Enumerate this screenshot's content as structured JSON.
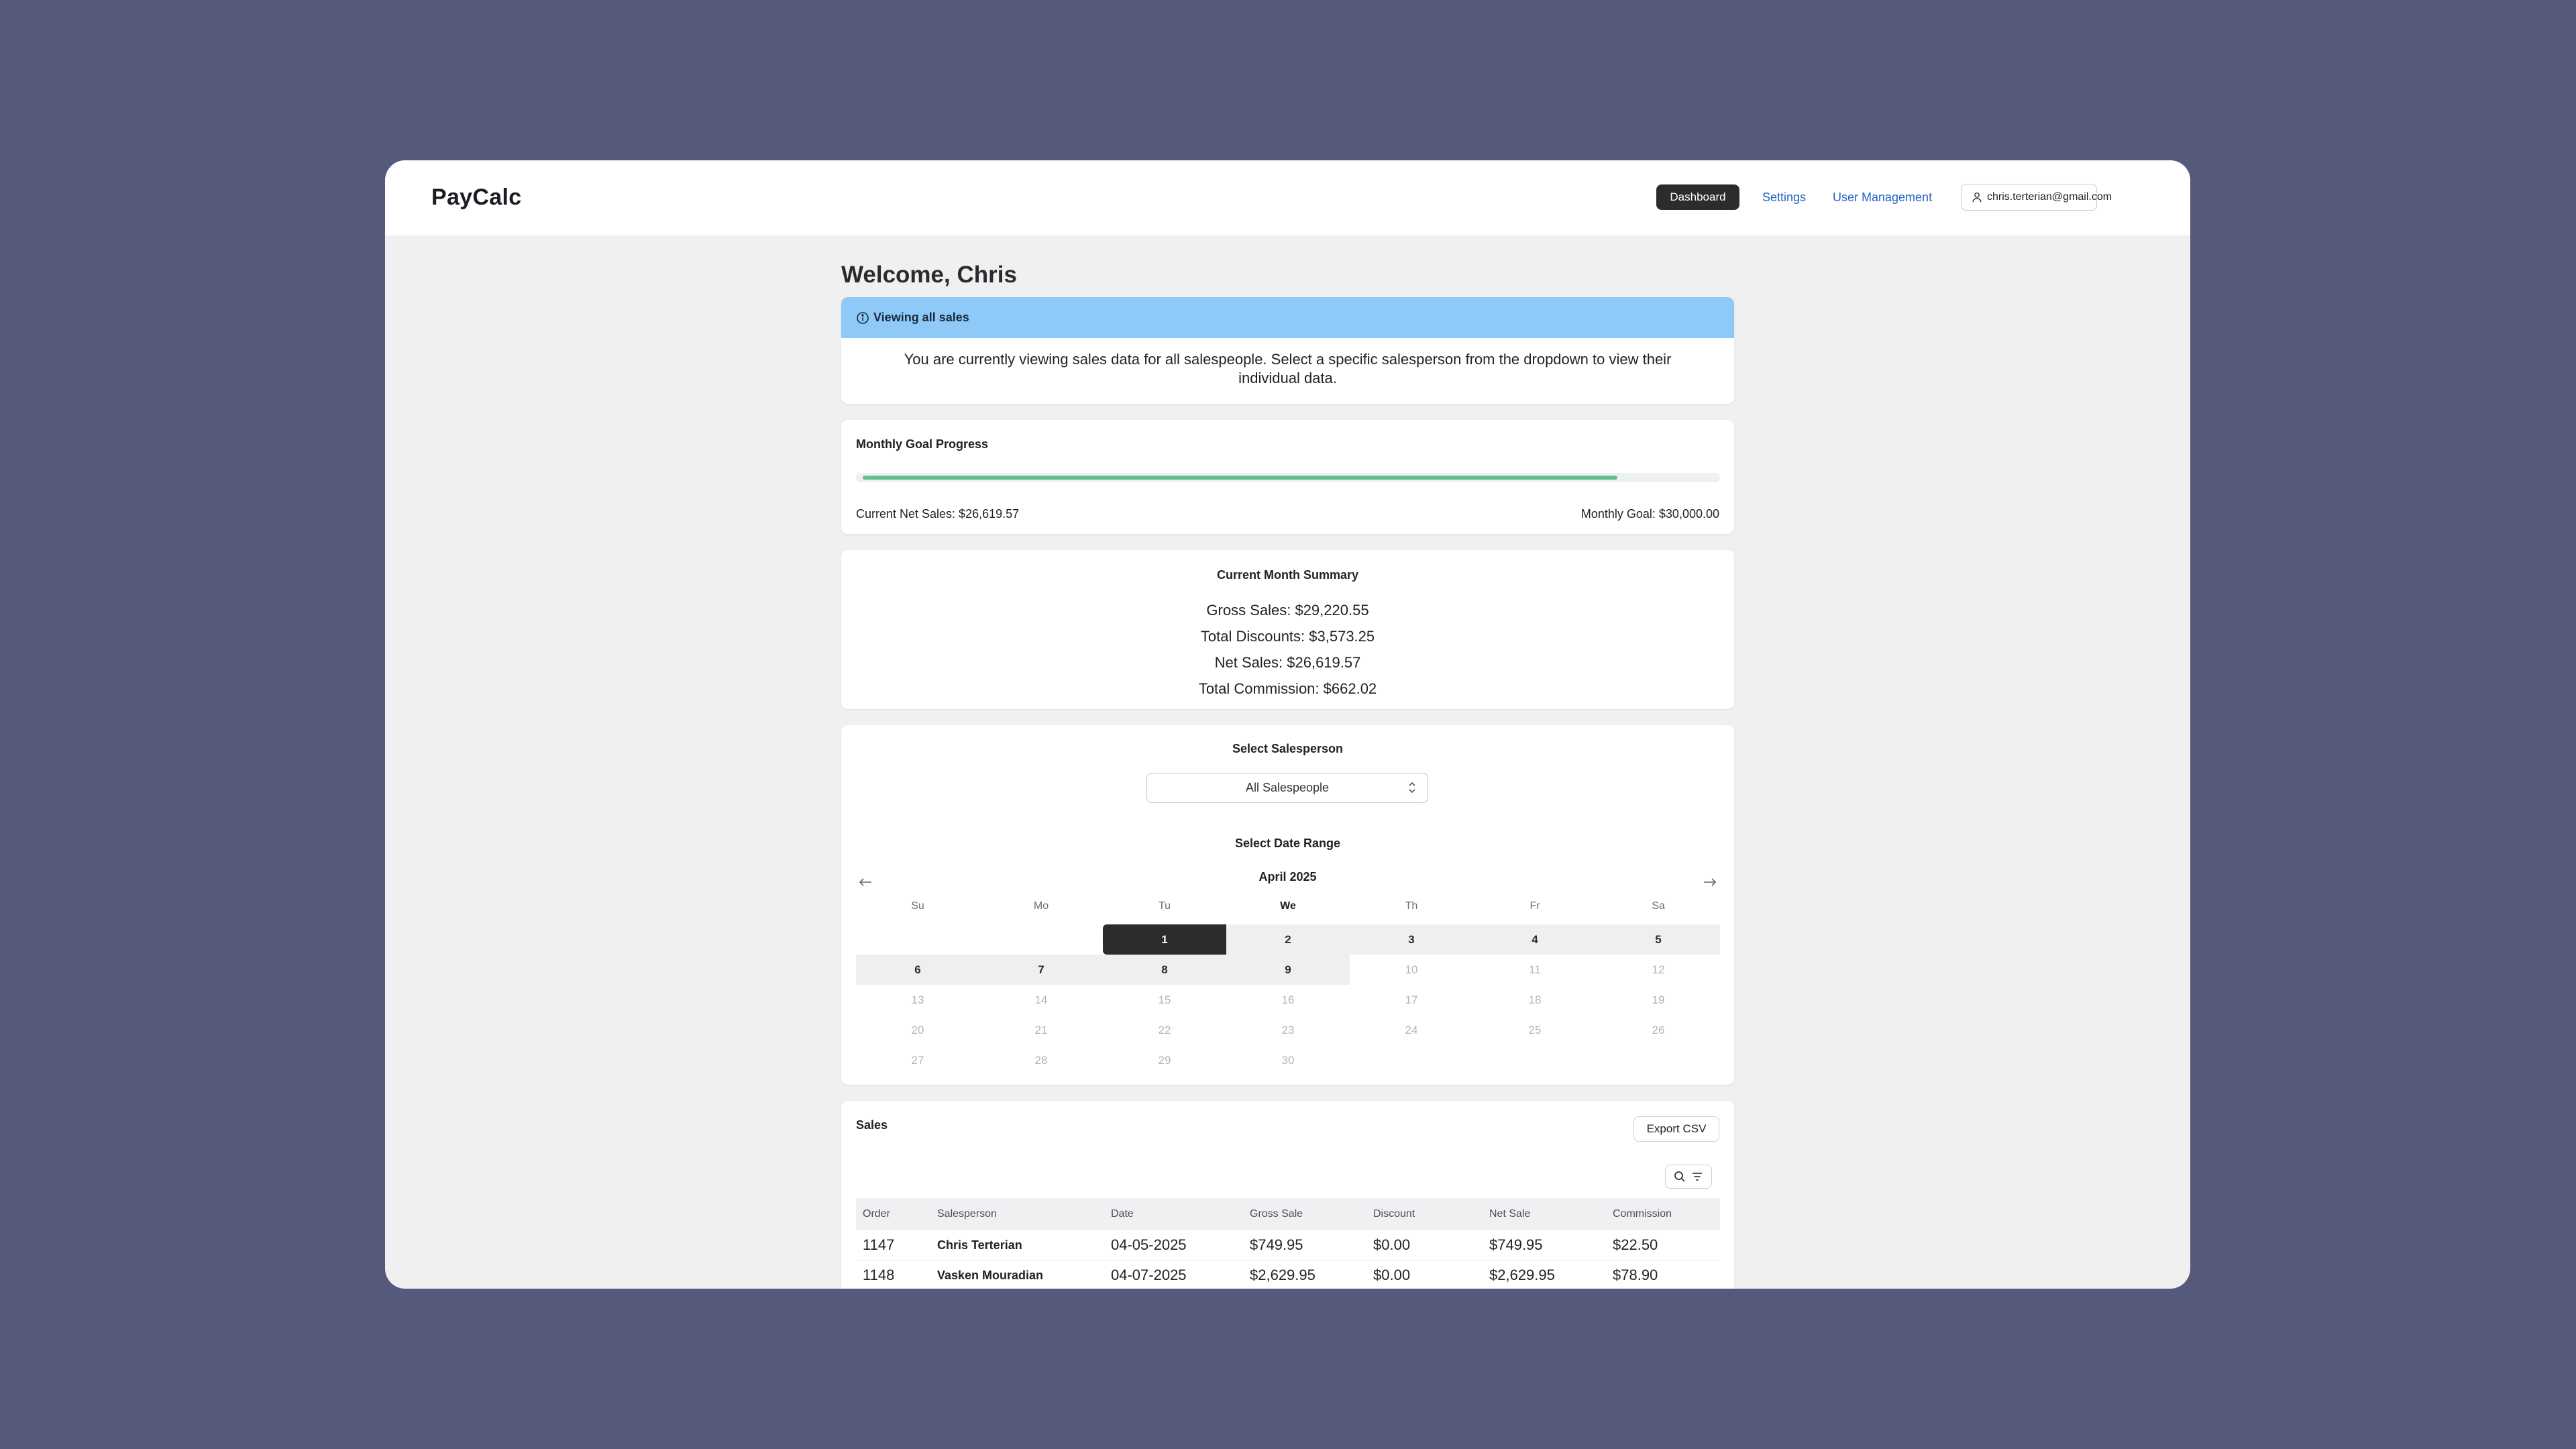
{
  "app": {
    "brand": "PayCalc"
  },
  "nav": {
    "dashboard": "Dashboard",
    "settings": "Settings",
    "user_management": "User Management",
    "user_email": "chris.terterian@gmail.com"
  },
  "welcome": "Welcome, Chris",
  "info": {
    "title": "Viewing all sales",
    "body": "You are currently viewing sales data for all salespeople. Select a specific salesperson from the dropdown to view their individual data."
  },
  "goal": {
    "title": "Monthly Goal Progress",
    "current": "Current Net Sales: $26,619.57",
    "target": "Monthly Goal: $30,000.00",
    "progress_fraction": 0.887
  },
  "summary": {
    "title": "Current Month Summary",
    "gross": "Gross Sales: $29,220.55",
    "discounts": "Total Discounts: $3,573.25",
    "net": "Net Sales: $26,619.57",
    "commission": "Total Commission: $662.02"
  },
  "filters": {
    "salesperson_title": "Select Salesperson",
    "salesperson_value": "All Salespeople",
    "date_title": "Select Date Range",
    "month": "April 2025",
    "weekdays": [
      "Su",
      "Mo",
      "Tu",
      "We",
      "Th",
      "Fr",
      "Sa"
    ],
    "weeks": [
      [
        "",
        "",
        "1",
        "2",
        "3",
        "4",
        "5"
      ],
      [
        "6",
        "7",
        "8",
        "9",
        "10",
        "11",
        "12"
      ],
      [
        "13",
        "14",
        "15",
        "16",
        "17",
        "18",
        "19"
      ],
      [
        "20",
        "21",
        "22",
        "23",
        "24",
        "25",
        "26"
      ],
      [
        "27",
        "28",
        "29",
        "30",
        "",
        "",
        ""
      ]
    ]
  },
  "sales": {
    "title": "Sales",
    "export": "Export CSV",
    "columns": [
      "Order",
      "Salesperson",
      "Date",
      "Gross Sale",
      "Discount",
      "Net Sale",
      "Commission"
    ],
    "rows": [
      [
        "1147",
        "Chris Terterian",
        "04-05-2025",
        "$749.95",
        "$0.00",
        "$749.95",
        "$22.50"
      ],
      [
        "1148",
        "Vasken Mouradian",
        "04-07-2025",
        "$2,629.95",
        "$0.00",
        "$2,629.95",
        "$78.90"
      ]
    ]
  }
}
